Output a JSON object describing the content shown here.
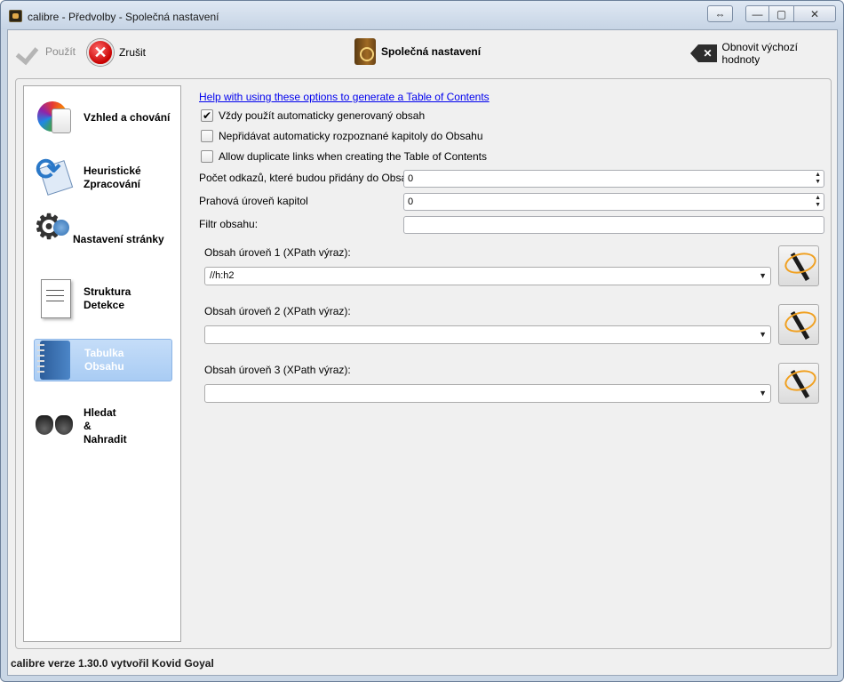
{
  "window": {
    "title": "calibre - Předvolby - Společná nastavení",
    "controls": {
      "resize": "⇔",
      "minimize": "—",
      "maximize": "▢",
      "close": "✕"
    }
  },
  "toolbar": {
    "apply_label": "Použít",
    "cancel_label": "Zrušit",
    "section_title": "Společná nastavení",
    "restore_label": "Obnovit výchozí hodnoty"
  },
  "sidebar": {
    "items": [
      {
        "label": "Vzhled a chování",
        "icon": "colors-icon"
      },
      {
        "label": "Heuristické\nZpracování",
        "icon": "heuristics-icon"
      },
      {
        "label": "Nastavení stránky",
        "icon": "gear-icon"
      },
      {
        "label": "Struktura\nDetekce",
        "icon": "document-icon"
      },
      {
        "label": "Tabulka\nObsahu",
        "icon": "notebook-icon",
        "active": true
      },
      {
        "label": "Hledat\n&\nNahradit",
        "icon": "binoculars-icon"
      }
    ]
  },
  "toc": {
    "help_link": "Help with using these options to generate a Table of Contents",
    "checkboxes": [
      {
        "label": "Vždy použít automaticky generovaný obsah",
        "checked": true,
        "mark": "✔"
      },
      {
        "label": "Nepřidávat automaticky rozpoznané kapitoly do Obsahu",
        "checked": false,
        "mark": ""
      },
      {
        "label": "Allow duplicate links when creating the Table of Contents",
        "checked": false,
        "mark": ""
      }
    ],
    "links_count_label": "Počet odkazů, které budou přidány do Obsahu",
    "links_count_value": "0",
    "chapter_threshold_label": "Prahová úroveň kapitol",
    "chapter_threshold_value": "0",
    "filter_label": "Filtr obsahu:",
    "filter_value": "",
    "levels": [
      {
        "label": "Obsah úroveň 1 (XPath výraz):",
        "value": "//h:h2"
      },
      {
        "label": "Obsah úroveň 2 (XPath výraz):",
        "value": ""
      },
      {
        "label": "Obsah úroveň 3 (XPath výraz):",
        "value": ""
      }
    ]
  },
  "status": {
    "text": "calibre verze 1.30.0 vytvořil Kovid Goyal"
  }
}
